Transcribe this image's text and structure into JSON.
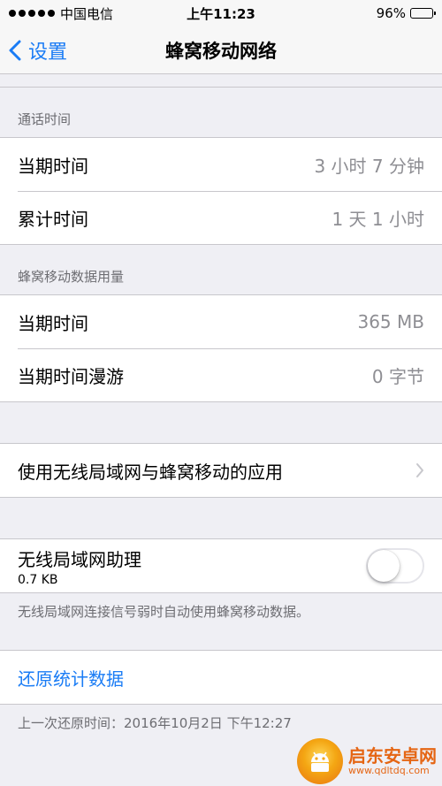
{
  "status_bar": {
    "carrier": "中国电信",
    "time": "上午11:23",
    "battery_percent": "96%",
    "battery_level": 0.96,
    "signal_bars": 5
  },
  "nav": {
    "back_label": "设置",
    "title": "蜂窝移动网络"
  },
  "call_time": {
    "header": "通话时间",
    "rows": [
      {
        "label": "当期时间",
        "value": "3 小时 7 分钟"
      },
      {
        "label": "累计时间",
        "value": "1 天 1 小时"
      }
    ]
  },
  "data_usage": {
    "header": "蜂窝移动数据用量",
    "rows": [
      {
        "label": "当期时间",
        "value": "365 MB"
      },
      {
        "label": "当期时间漫游",
        "value": "0 字节"
      }
    ]
  },
  "apps_row": {
    "label": "使用无线局域网与蜂窝移动的应用"
  },
  "wifi_assist": {
    "title": "无线局域网助理",
    "subtitle": "0.7 KB",
    "enabled": false,
    "description": "无线局域网连接信号弱时自动使用蜂窝移动数据。"
  },
  "reset": {
    "label": "还原统计数据",
    "last_reset": "上一次还原时间：2016年10月2日 下午12:27"
  },
  "watermark": {
    "title": "启东安卓网",
    "url": "www.qdltdq.com"
  },
  "colors": {
    "accent": "#1a7cf5",
    "background": "#efeff4",
    "secondary_text": "#8e8e93",
    "watermark": "#e55a00"
  }
}
